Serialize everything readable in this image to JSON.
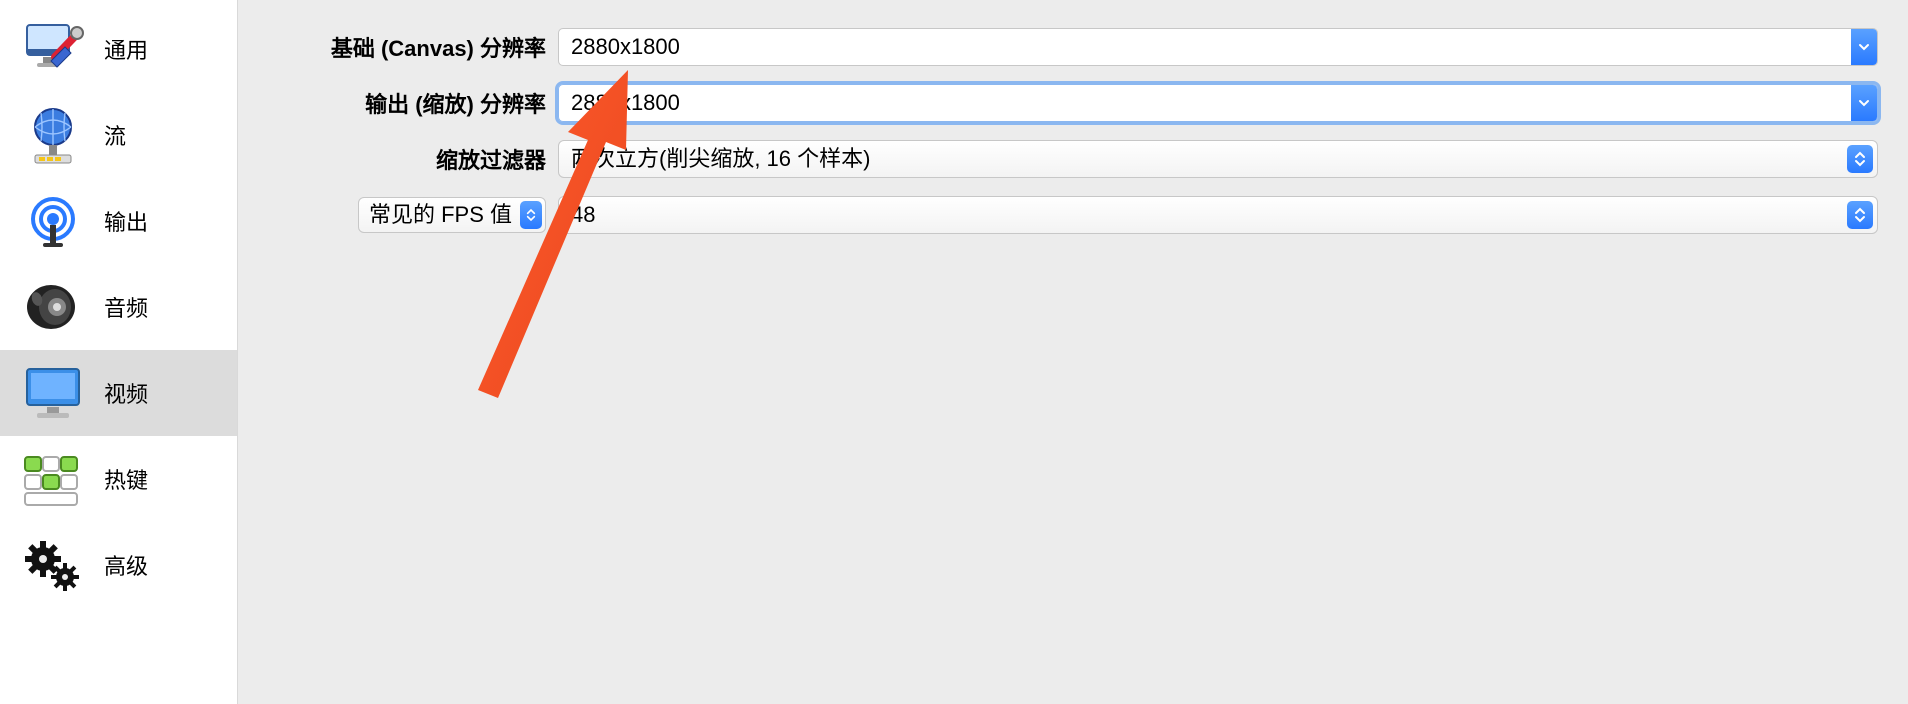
{
  "sidebar": {
    "items": [
      {
        "label": "通用"
      },
      {
        "label": "流"
      },
      {
        "label": "输出"
      },
      {
        "label": "音频"
      },
      {
        "label": "视频"
      },
      {
        "label": "热键"
      },
      {
        "label": "高级"
      }
    ],
    "selected_index": 4
  },
  "form": {
    "base_resolution": {
      "label": "基础 (Canvas) 分辨率",
      "value": "2880x1800"
    },
    "output_resolution": {
      "label": "输出 (缩放) 分辨率",
      "value": "2880x1800"
    },
    "downscale_filter": {
      "label": "缩放过滤器",
      "value": "两次立方(削尖缩放, 16 个样本)"
    },
    "fps_type": {
      "label": "常见的 FPS 值"
    },
    "fps_value": {
      "value": "48"
    }
  }
}
